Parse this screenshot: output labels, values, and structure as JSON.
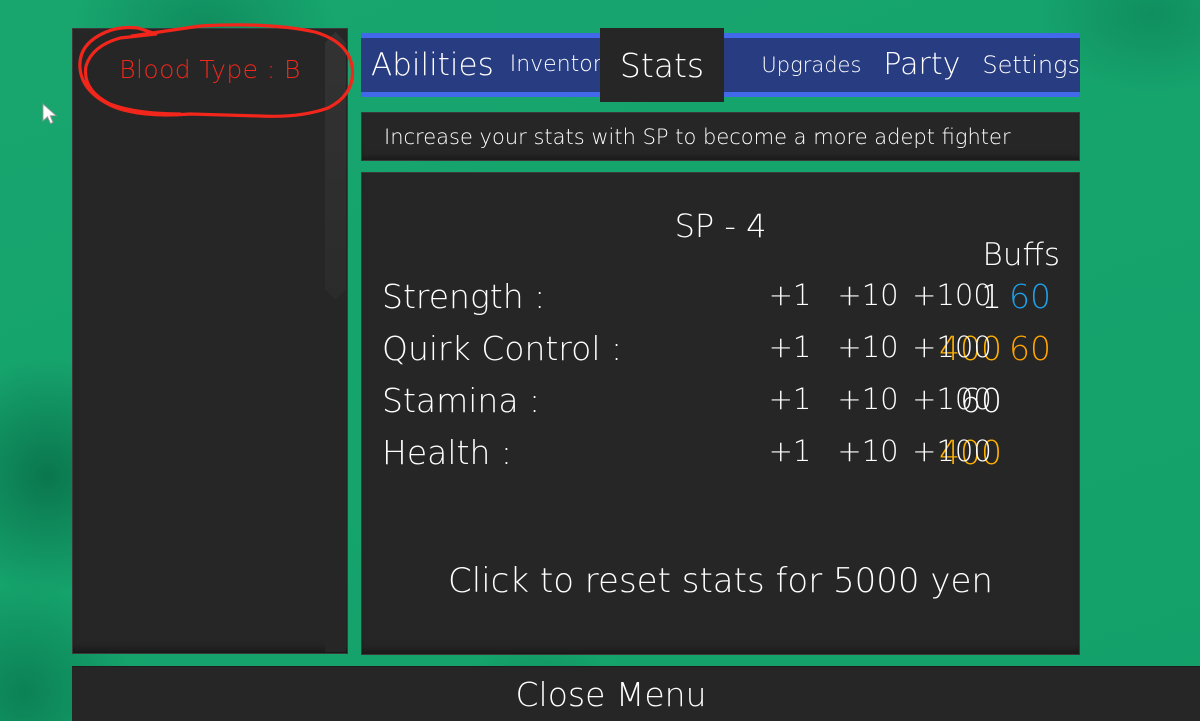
{
  "background": {
    "color": "#17a870"
  },
  "cursor": {
    "icon": "mouse-pointer-icon"
  },
  "character_panel": {
    "blood_type": "Blood Type : B",
    "annotation": {
      "shape": "hand-drawn-ellipse",
      "color": "#f2261b"
    }
  },
  "tabs": {
    "items": [
      {
        "label": "Abilities",
        "active": false
      },
      {
        "label": "Inventory",
        "active": false
      },
      {
        "label": "Stats",
        "active": true
      },
      {
        "label": "Upgrades",
        "active": false
      },
      {
        "label": "Party",
        "active": false
      },
      {
        "label": "Settings",
        "active": false
      }
    ],
    "active_label": "Stats",
    "bar_color": "#283c82",
    "border_color": "#4169e9"
  },
  "description": {
    "text": "Increase your stats with SP to become a more adept fighter"
  },
  "stats_panel": {
    "sp_label": "SP - 4",
    "buffs_header": "Buffs",
    "increment_labels": {
      "one": "+1",
      "ten": "+10",
      "hundred": "+100"
    },
    "rows": [
      {
        "name": "Strength :",
        "value": "1",
        "value_color": "white",
        "plus1": "+1",
        "plus10": "+10",
        "plus100": "+100",
        "buff": "60",
        "buff_color": "cyan"
      },
      {
        "name": "Quirk Control :",
        "value": "400",
        "value_color": "gold",
        "plus1": "+1",
        "plus10": "+10",
        "plus100": "+100",
        "buff": "60",
        "buff_color": "orange"
      },
      {
        "name": "Stamina :",
        "value": "60",
        "value_color": "white",
        "plus1": "+1",
        "plus10": "+10",
        "plus100": "+100",
        "buff": "",
        "buff_color": "none"
      },
      {
        "name": "Health :",
        "value": "400",
        "value_color": "gold",
        "plus1": "+1",
        "plus10": "+10",
        "plus100": "+100",
        "buff": "",
        "buff_color": "none"
      }
    ],
    "reset_text": "Click to reset stats for 5000 yen",
    "colors": {
      "gold": "#ffb100",
      "cyan": "#1f9fe6",
      "orange": "#ffa200",
      "panel": "#262626"
    }
  },
  "footer": {
    "close_label": "Close Menu"
  }
}
